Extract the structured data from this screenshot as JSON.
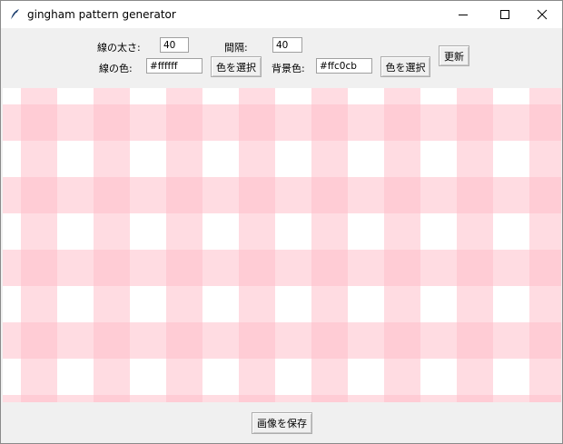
{
  "window": {
    "title": "gingham pattern generator"
  },
  "icons": {
    "app": "feather-icon",
    "minimize": "minimize-icon",
    "maximize": "maximize-icon",
    "close": "close-icon"
  },
  "controls": {
    "line_width_label": "線の太さ:",
    "line_width_value": "40",
    "spacing_label": "間隔:",
    "spacing_value": "40",
    "line_color_label": "線の色:",
    "line_color_value": "#ffffff",
    "line_color_button": "色を選択",
    "bg_color_label": "背景色:",
    "bg_color_value": "#ffc0cb",
    "bg_color_button": "色を選択",
    "update_button": "更新"
  },
  "pattern": {
    "line_color": "#ffffff",
    "background_color": "#ffc0cb",
    "line_width": 40,
    "spacing": 40
  },
  "footer": {
    "save_button": "画像を保存"
  }
}
